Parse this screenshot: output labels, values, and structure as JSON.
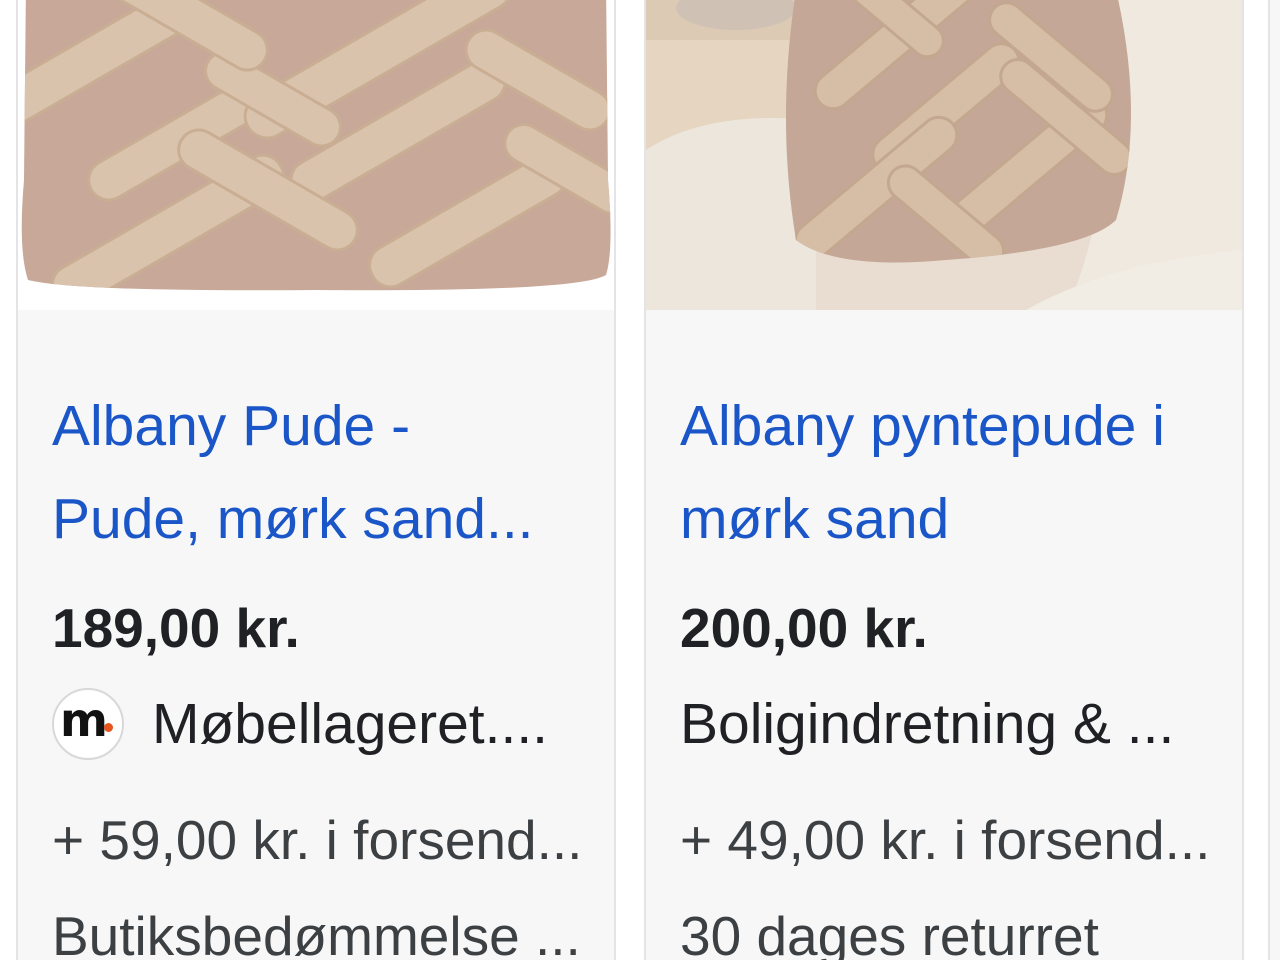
{
  "results": [
    {
      "title": "Albany Pude -\nPude, mørk sand...",
      "price": "189,00 kr.",
      "store_name": "Møbellageret....",
      "store_logo_letter": "m",
      "store_logo_icon": "mobellageret-logo",
      "shipping": "+ 59,00 kr. i forsend...",
      "extra": "Butiksbedømmelse ...",
      "image_icon": "pillow-product-image"
    },
    {
      "title": "Albany pyntepude i\nmørk sand",
      "price": "200,00 kr.",
      "store_name": "Boligindretning & ...",
      "shipping": "+ 49,00 kr. i forsend...",
      "extra": "30 dages returret",
      "image_icon": "pillow-on-chair-image"
    }
  ],
  "colors": {
    "link": "#1a56c8",
    "text": "#202124",
    "secondary_text": "#3c4043",
    "card_bg": "#f7f7f8",
    "logo_accent": "#e8561f",
    "pillow": "#c9aa98",
    "tuft": "#d8c0a8"
  }
}
